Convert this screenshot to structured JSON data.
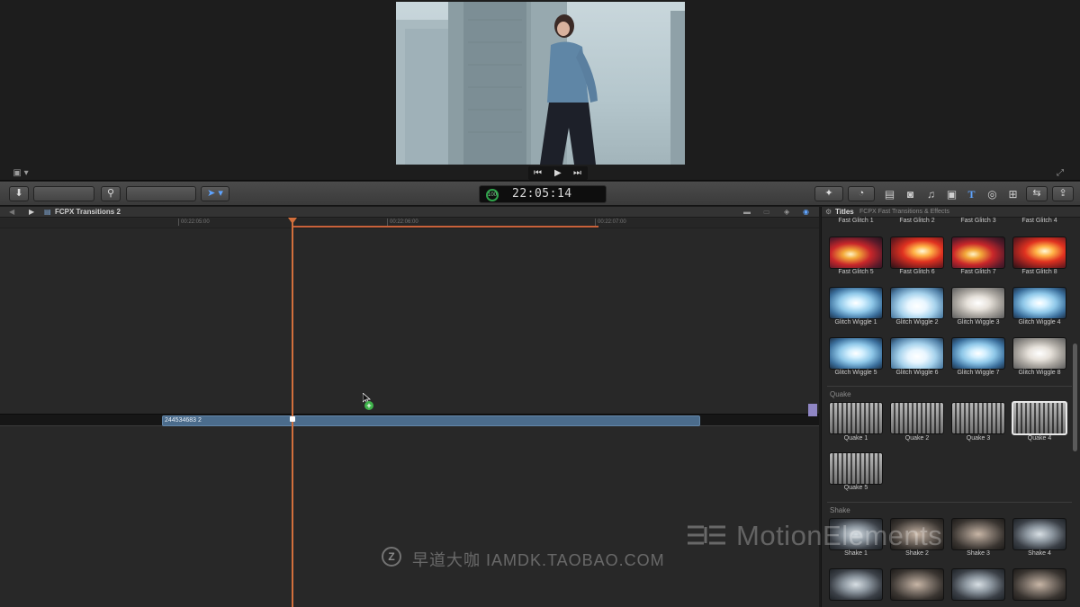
{
  "viewer": {
    "transport": {
      "prev": "⏮",
      "play": "▶",
      "next": "⏭"
    },
    "view_menu": "▣ ▾",
    "fullscreen": "⤢"
  },
  "toolbar": {
    "import": "⬇",
    "key": "⚲",
    "arrow": "➤ ▾",
    "timecode": "22:05:14",
    "timecode_ring": "100",
    "tools": [
      "✦",
      "◔",
      "▤",
      "◙",
      "♫",
      "▣",
      "T",
      "◎",
      "⊞",
      "⇆",
      "⇪"
    ]
  },
  "timeline": {
    "project_name": "FCPX Transitions 2",
    "ruler": [
      {
        "label": "00:22:05:00"
      },
      {
        "label": "00:22:06:00"
      },
      {
        "label": "00:22:07:00"
      }
    ],
    "clip_name": "244534683 2"
  },
  "browser": {
    "title": "Titles",
    "subtitle": "FCPX Fast Transitions & Effects",
    "top_labels": [
      "Fast Glitch 1",
      "Fast Glitch 2",
      "Fast Glitch 3",
      "Fast Glitch 4"
    ],
    "rows": [
      [
        "Fast Glitch 5",
        "Fast Glitch 6",
        "Fast Glitch 7",
        "Fast Glitch 8"
      ],
      [
        "Glitch Wiggle 1",
        "Glitch Wiggle 2",
        "Glitch Wiggle 3",
        "Glitch Wiggle 4"
      ],
      [
        "Glitch Wiggle 5",
        "Glitch Wiggle 6",
        "Glitch Wiggle 7",
        "Glitch Wiggle 8"
      ]
    ],
    "section_quake": "Quake",
    "quake": [
      "Quake 1",
      "Quake 2",
      "Quake 3",
      "Quake 4",
      "Quake 5"
    ],
    "section_shake": "Shake",
    "shake": [
      "Shake 1",
      "Shake 2",
      "Shake 3",
      "Shake 4"
    ]
  },
  "watermark": {
    "brand": "MotionElements",
    "cn_text": "早道大咖  IAMDK.TAOBAO.COM",
    "logo_letter": "Z"
  }
}
